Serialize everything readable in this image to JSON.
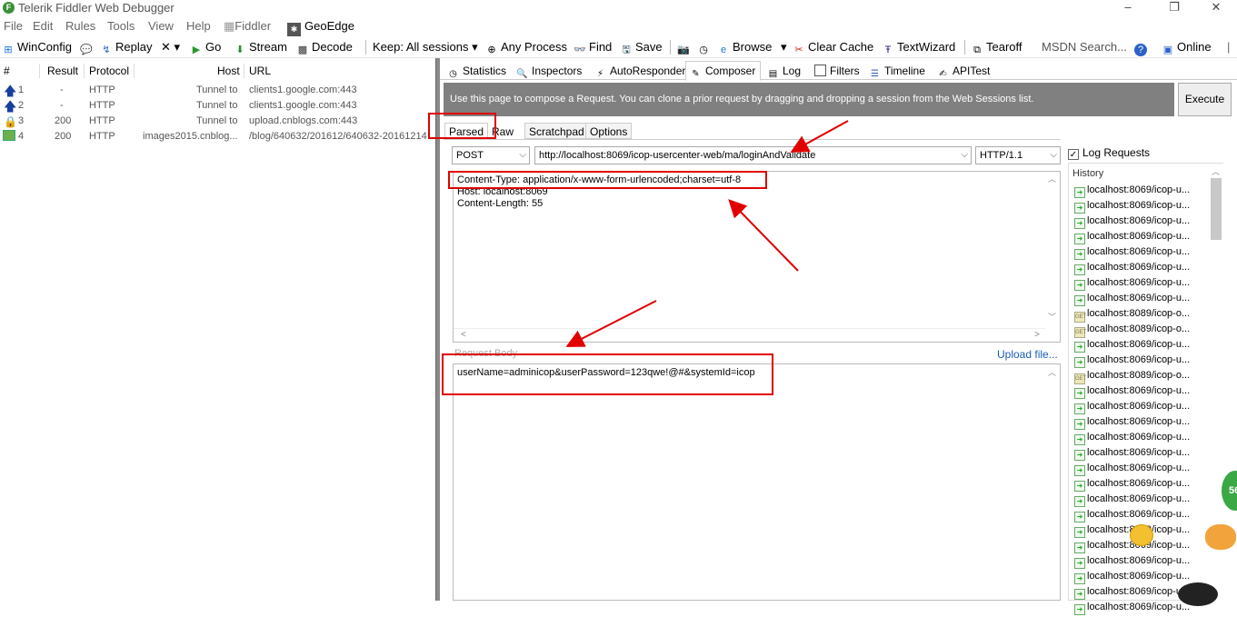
{
  "window": {
    "title": "Telerik Fiddler Web Debugger",
    "app_icon": "fiddler-icon",
    "controls": [
      "–",
      "❐",
      "✕"
    ]
  },
  "menu": [
    "File",
    "Edit",
    "Rules",
    "Tools",
    "View",
    "Help",
    "Fiddler",
    "GeoEdge"
  ],
  "toolbar": {
    "winconfig": "WinConfig",
    "replay": "Replay",
    "remove": "✕ ▾",
    "go": "Go",
    "stream": "Stream",
    "decode": "Decode",
    "keep": "Keep: All sessions ▾",
    "any_process": "Any Process",
    "find": "Find",
    "save": "Save",
    "browse": "Browse",
    "browse_dd": "▾",
    "clear_cache": "Clear Cache",
    "textwizard": "TextWizard",
    "tearoff": "Tearoff",
    "msdn_search": "MSDN Search...",
    "online": "Online"
  },
  "sessions": {
    "columns": [
      "#",
      "Result",
      "Protocol",
      "Host",
      "URL"
    ],
    "rows": [
      {
        "num": "1",
        "result": "-",
        "protocol": "HTTP",
        "host": "Tunnel to",
        "url": "clients1.google.com:443",
        "icon": "up-arrow-icon"
      },
      {
        "num": "2",
        "result": "-",
        "protocol": "HTTP",
        "host": "Tunnel to",
        "url": "clients1.google.com:443",
        "icon": "up-arrow-icon"
      },
      {
        "num": "3",
        "result": "200",
        "protocol": "HTTP",
        "host": "Tunnel to",
        "url": "upload.cnblogs.com:443",
        "icon": "lock-icon"
      },
      {
        "num": "4",
        "result": "200",
        "protocol": "HTTP",
        "host": "images2015.cnblog...",
        "url": "/blog/640632/201612/640632-20161214",
        "icon": "image-icon"
      }
    ]
  },
  "tabs": [
    "Statistics",
    "Inspectors",
    "AutoResponder",
    "Composer",
    "Log",
    "Filters",
    "Timeline",
    "APITest"
  ],
  "active_tab": "Composer",
  "composer": {
    "banner": "Use this page to compose a Request. You can clone a prior request by dragging and dropping a session from the Web Sessions list.",
    "execute": "Execute",
    "subtabs": [
      "Parsed",
      "Raw",
      "Scratchpad",
      "Options"
    ],
    "method": "POST",
    "url": "http://localhost:8069/icop-usercenter-web/ma/loginAndValidate",
    "version": "HTTP/1.1",
    "headers": [
      "Content-Type: application/x-www-form-urlencoded;charset=utf-8",
      "Host: localhost:8069",
      "Content-Length: 55"
    ],
    "request_body_label": "Request Body",
    "upload_file": "Upload file...",
    "body": "userName=adminicop&userPassword=123qwe!@#&systemId=icop"
  },
  "history": {
    "log_requests": "Log Requests",
    "log_requests_checked": true,
    "label": "History",
    "items": [
      {
        "text": "localhost:8069/icop-u...",
        "kind": "post"
      },
      {
        "text": "localhost:8069/icop-u...",
        "kind": "post"
      },
      {
        "text": "localhost:8069/icop-u...",
        "kind": "post"
      },
      {
        "text": "localhost:8069/icop-u...",
        "kind": "post"
      },
      {
        "text": "localhost:8069/icop-u...",
        "kind": "post"
      },
      {
        "text": "localhost:8069/icop-u...",
        "kind": "post"
      },
      {
        "text": "localhost:8069/icop-u...",
        "kind": "post"
      },
      {
        "text": "localhost:8069/icop-u...",
        "kind": "post"
      },
      {
        "text": "localhost:8089/icop-o...",
        "kind": "get"
      },
      {
        "text": "localhost:8089/icop-o...",
        "kind": "get"
      },
      {
        "text": "localhost:8069/icop-u...",
        "kind": "post"
      },
      {
        "text": "localhost:8069/icop-u...",
        "kind": "post"
      },
      {
        "text": "localhost:8089/icop-o...",
        "kind": "get"
      },
      {
        "text": "localhost:8069/icop-u...",
        "kind": "post"
      },
      {
        "text": "localhost:8069/icop-u...",
        "kind": "post"
      },
      {
        "text": "localhost:8069/icop-u...",
        "kind": "post"
      },
      {
        "text": "localhost:8069/icop-u...",
        "kind": "post"
      },
      {
        "text": "localhost:8069/icop-u...",
        "kind": "post"
      },
      {
        "text": "localhost:8069/icop-u...",
        "kind": "post"
      },
      {
        "text": "localhost:8069/icop-u...",
        "kind": "post"
      },
      {
        "text": "localhost:8069/icop-u...",
        "kind": "post"
      },
      {
        "text": "localhost:8069/icop-u...",
        "kind": "post"
      },
      {
        "text": "localhost:8069/icop-u...",
        "kind": "post"
      },
      {
        "text": "localhost:8069/icop-u...",
        "kind": "post"
      },
      {
        "text": "localhost:8069/icop-u...",
        "kind": "post"
      },
      {
        "text": "localhost:8069/icop-u...",
        "kind": "post"
      },
      {
        "text": "localhost:8069/icop-u...",
        "kind": "post"
      },
      {
        "text": "localhost:8069/icop-u...",
        "kind": "post"
      }
    ]
  },
  "overlay": {
    "badge": "56"
  },
  "colors": {
    "annotation": "#e00000",
    "banner": "#808080",
    "link": "#1a5fb4"
  }
}
